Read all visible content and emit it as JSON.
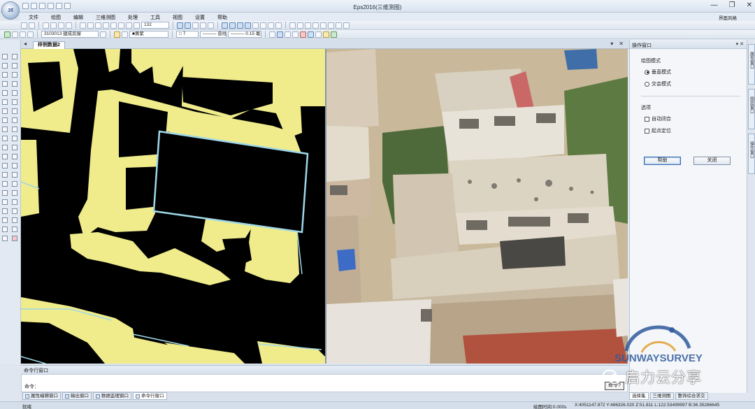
{
  "window": {
    "title": "Eps2016(三维测图)",
    "orb_label": "35",
    "controls": [
      "—",
      "❐",
      "✕"
    ],
    "ui_layout_label": "界面风格"
  },
  "menu": {
    "items": [
      "文件",
      "绘图",
      "编辑",
      "三维测图",
      "处理",
      "工具",
      "视图",
      "设置",
      "帮助"
    ]
  },
  "toolbar1": {
    "zoom_value": "132"
  },
  "toolbar2": {
    "layer_code": "3103013 建成房屋",
    "color_name": "■黄紫",
    "line_weight": "□ 7",
    "line_style": "——— 普线",
    "line_width": "——— 0.15 毫米"
  },
  "document": {
    "tab_label": "样例数据2",
    "controls": [
      "▾",
      "✕"
    ]
  },
  "map_view": {
    "colors": {
      "background": "#000000",
      "fill": "#f0ec8c",
      "edge": "#9fd8e8"
    }
  },
  "op_panel": {
    "title": "操作窗口",
    "controls": "▾ ✕",
    "section_mode": "绘图模式",
    "radio_vertical": "垂直模式",
    "radio_interactive": "交会模式",
    "radio_selected": "vertical",
    "section_options": "选项",
    "check_auto_close": "自动闭合",
    "check_point_locate": "起点定位",
    "help_button": "帮助",
    "close_button": "关闭"
  },
  "side_tabs": [
    "属性窗口",
    "图层窗口",
    "操作窗口"
  ],
  "command": {
    "header": "命令行窗口",
    "prompt": "命令：",
    "callout": "命令?",
    "tabs": [
      "属性编辑窗口",
      "输出窗口",
      "数据监理窗口",
      "命令行窗口"
    ],
    "active_tab": 3
  },
  "right_tabs": {
    "items": [
      "选择集",
      "三维测图",
      "整饰综合求交"
    ],
    "active": 0
  },
  "status": {
    "left": "就绪",
    "time": "绘图时间:0.000s",
    "coords": "X:4051147.872 Y:486326.020 Z:51.811 L:122.53499997 B:36.35286645"
  },
  "watermark": {
    "brand": "SUNWAYSURVEY",
    "wechat_text": "启力云分享"
  }
}
